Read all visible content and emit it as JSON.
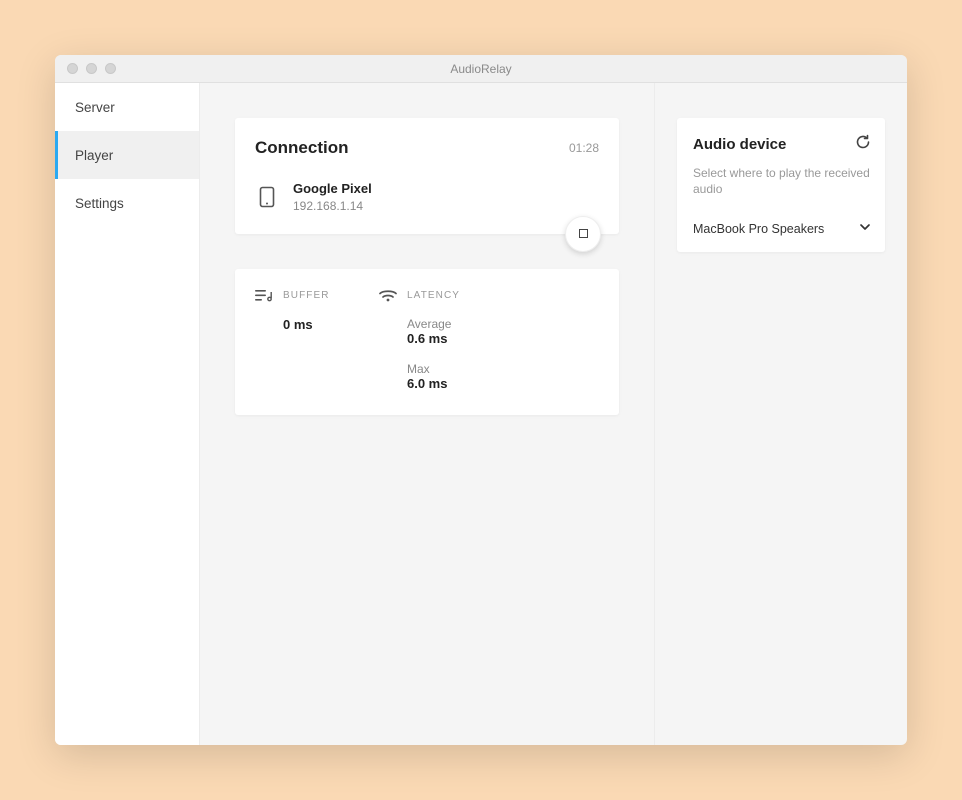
{
  "window": {
    "title": "AudioRelay"
  },
  "sidebar": {
    "items": [
      {
        "label": "Server"
      },
      {
        "label": "Player"
      },
      {
        "label": "Settings"
      }
    ]
  },
  "connection": {
    "title": "Connection",
    "time": "01:28",
    "device_name": "Google Pixel",
    "device_ip": "192.168.1.14"
  },
  "stats": {
    "buffer_label": "BUFFER",
    "buffer_value": "0 ms",
    "latency_label": "LATENCY",
    "latency_avg_label": "Average",
    "latency_avg_value": "0.6 ms",
    "latency_max_label": "Max",
    "latency_max_value": "6.0 ms"
  },
  "audio_device": {
    "title": "Audio device",
    "description": "Select where to play the received audio",
    "selected": "MacBook Pro Speakers"
  }
}
